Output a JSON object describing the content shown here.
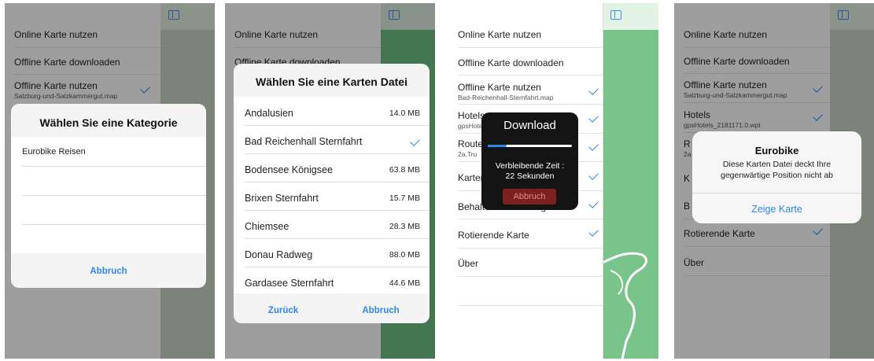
{
  "screen1": {
    "menu": [
      {
        "label": "Online Karte nutzen"
      },
      {
        "label": "Offline Karte downloaden"
      },
      {
        "label": "Offline Karte nutzen",
        "sub": "Salzburg-und-Salzkammergut.map",
        "checked": true
      }
    ],
    "sheet": {
      "title": "Wählen Sie eine Kategorie",
      "items": [
        "Eurobike Reisen"
      ],
      "cancel_label": "Abbruch"
    }
  },
  "screen2": {
    "menu": [
      {
        "label": "Online Karte nutzen"
      },
      {
        "label": "Offline Karte downloaden"
      }
    ],
    "sheet": {
      "title": "Wählen Sie eine Karten Datei",
      "files": [
        {
          "name": "Andalusien",
          "size": "14.0 MB"
        },
        {
          "name": "Bad Reichenhall Sternfahrt",
          "size": "",
          "checked": true
        },
        {
          "name": "Bodensee Königsee",
          "size": "63.8 MB"
        },
        {
          "name": "Brixen Sternfahrt",
          "size": "15.7 MB"
        },
        {
          "name": "Chiemsee",
          "size": "28.3 MB"
        },
        {
          "name": "Donau Radweg",
          "size": "88.0 MB"
        },
        {
          "name": "Gardasee Sternfahrt",
          "size": "44.6 MB"
        }
      ],
      "back_label": "Zurück",
      "cancel_label": "Abbruch"
    }
  },
  "screen3": {
    "menu": [
      {
        "label": "Online Karte nutzen"
      },
      {
        "label": "Offline Karte downloaden"
      },
      {
        "label": "Offline Karte nutzen",
        "sub": "Bad-Reichenhall-Sternfahrt.map",
        "checked": true
      },
      {
        "label": "Hotels",
        "sub": "gpsHotels",
        "checked": true
      },
      {
        "label": "Routen",
        "sub": "2a.Tru",
        "checked": true
      },
      {
        "label": "Kartenfolge",
        "checked": true
      },
      {
        "label": "Behalte Blickrichtung",
        "checked": true
      },
      {
        "label": "Rotierende Karte",
        "checked": true
      },
      {
        "label": "Über"
      }
    ],
    "download": {
      "title": "Download",
      "progress": 0.22,
      "remaining_label": "Verbleibende Zeit :",
      "remaining_value": "22 Sekunden",
      "abort_label": "Abbruch"
    }
  },
  "screen4": {
    "menu": [
      {
        "label": "Online Karte nutzen"
      },
      {
        "label": "Offline Karte downloaden"
      },
      {
        "label": "Offline Karte nutzen",
        "sub": "Salzburg-und-Salzkammergut.map",
        "checked": true
      },
      {
        "label": "Hotels",
        "sub": "gpsHotels_2181171.0.wpt",
        "checked": true
      },
      {
        "label": "R",
        "sub": "2a"
      },
      {
        "label": "K"
      },
      {
        "label": "B"
      },
      {
        "label": "Rotierende Karte",
        "checked": true
      },
      {
        "label": "Über"
      }
    ],
    "alert": {
      "title": "Eurobike",
      "message_line1": "Diese Karten Datei deckt Ihre",
      "message_line2": "gegenwärtige Position nicht ab",
      "button_label": "Zeige Karte"
    }
  },
  "colors": {
    "accent": "#2f86ea",
    "map_green": "#78c38b",
    "map_gray": "#c9d3c2"
  }
}
